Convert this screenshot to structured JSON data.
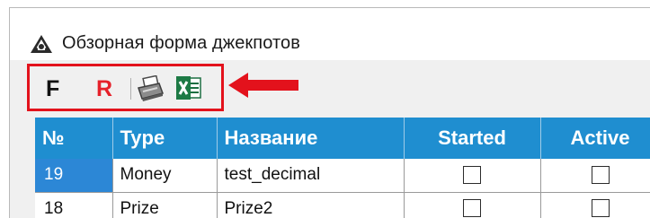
{
  "window": {
    "title": "Обзорная форма джекпотов",
    "title_icon": "app-logo-icon"
  },
  "toolbar": {
    "filter_label": "F",
    "reset_label": "R",
    "print_icon": "printer-icon",
    "excel_icon": "excel-icon",
    "reset_color": "#e6212a"
  },
  "annotation": {
    "box_color": "#e3121c",
    "arrow_icon": "left-arrow-icon"
  },
  "table": {
    "header_color": "#1f8ed0",
    "selected_color": "#2c87d6",
    "columns": [
      "№",
      "Type",
      "Название",
      "Started",
      "Active"
    ],
    "rows": [
      {
        "number": "19",
        "type": "Money",
        "name": "test_decimal",
        "started": false,
        "active": false,
        "selected": true
      },
      {
        "number": "18",
        "type": "Prize",
        "name": "Prize2",
        "started": false,
        "active": false,
        "selected": false
      }
    ]
  }
}
